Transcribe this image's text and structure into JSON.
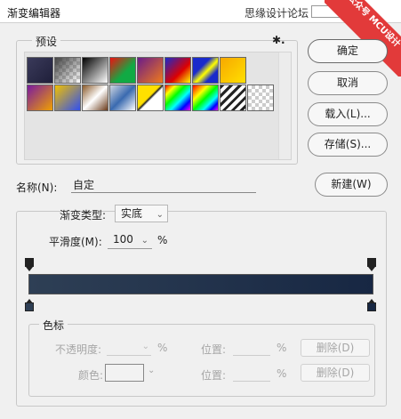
{
  "window": {
    "title": "渐变编辑器",
    "watermark_text": "思缘设计论坛",
    "corner_badge": "公众号 MCU设计"
  },
  "presets": {
    "legend": "预设",
    "gear_glyph": "✱."
  },
  "buttons": {
    "ok": "确定",
    "cancel": "取消",
    "load": "载入(L)...",
    "save": "存储(S)...",
    "new": "新建(W)"
  },
  "name": {
    "label": "名称(N):",
    "value": "自定"
  },
  "gradient": {
    "type_label": "渐变类型:",
    "type_value": "实底",
    "smoothness_label": "平滑度(M):",
    "smoothness_value": "100",
    "smoothness_unit": "%"
  },
  "color_stops": {
    "legend": "色标",
    "opacity_label": "不透明度:",
    "opacity_unit": "%",
    "location_label": "位置:",
    "location_unit": "%",
    "delete_label": "删除(D)",
    "color_label": "颜色:",
    "location2_label": "位置:",
    "location2_unit": "%",
    "delete2_label": "删除(D)"
  },
  "colors": {
    "gradient_start": "#2e3f55",
    "gradient_end": "#172743",
    "badge": "#e23a3a"
  }
}
